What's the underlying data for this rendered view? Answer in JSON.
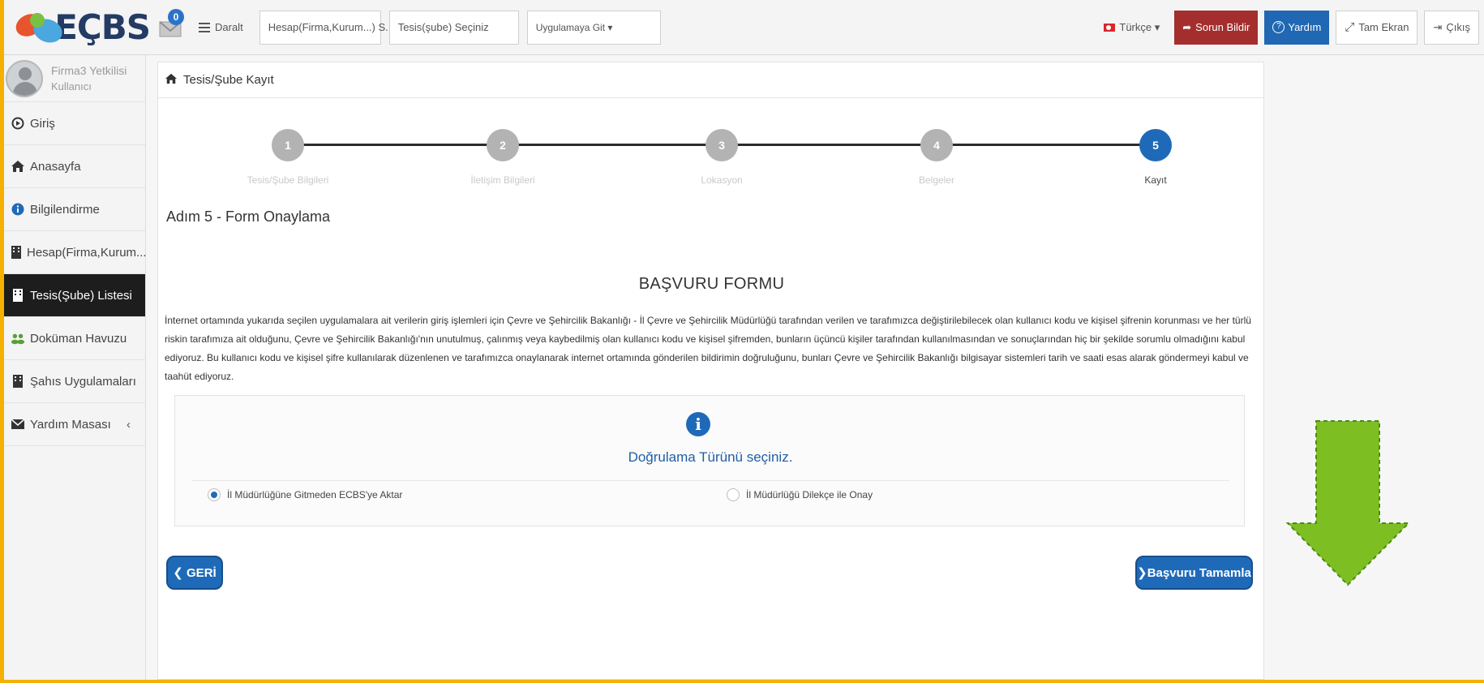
{
  "header": {
    "logo_text": "EÇBS",
    "mail_badge": "0",
    "collapse_label": "Daralt",
    "account_select": "Hesap(Firma,Kurum...) S...",
    "facility_select": "Tesis(şube) Seçiniz",
    "app_select": "Uygulamaya Git ▾",
    "language": "Türkçe ▾",
    "report_issue": "Sorun Bildir",
    "help": "Yardım",
    "fullscreen": "Tam Ekran",
    "logout": "Çıkış"
  },
  "sidebar": {
    "user_name": "Firma3 Yetkilisi",
    "user_role": "Kullanıcı",
    "items": [
      {
        "label": "Giriş",
        "icon": "sign-in-icon"
      },
      {
        "label": "Anasayfa",
        "icon": "home-icon"
      },
      {
        "label": "Bilgilendirme",
        "icon": "info-icon"
      },
      {
        "label": "Hesap(Firma,Kurum...)",
        "icon": "building-icon"
      },
      {
        "label": "Tesis(Şube) Listesi",
        "icon": "building-icon",
        "active": true
      },
      {
        "label": "Doküman Havuzu",
        "icon": "users-icon"
      },
      {
        "label": "Şahıs Uygulamaları",
        "icon": "building-icon"
      },
      {
        "label": "Yardım Masası",
        "icon": "envelope-icon"
      }
    ]
  },
  "page": {
    "breadcrumb": "Tesis/Şube Kayıt",
    "wizard_steps": [
      {
        "number": "1",
        "label": "Tesis/Şube Bilgileri"
      },
      {
        "number": "2",
        "label": "İletişim Bilgileri"
      },
      {
        "number": "3",
        "label": "Lokasyon"
      },
      {
        "number": "4",
        "label": "Belgeler"
      },
      {
        "number": "5",
        "label": "Kayıt",
        "current": true
      }
    ],
    "step_title": "Adım 5 - Form Onaylama",
    "form_title": "BAŞVURU FORMU",
    "legal_text": "İnternet ortamında yukarıda seçilen uygulamalara ait verilerin giriş işlemleri için Çevre ve Şehircilik Bakanlığı - İl Çevre ve Şehircilik Müdürlüğü tarafından verilen ve tarafımızca değiştirilebilecek olan kullanıcı kodu ve kişisel şifrenin korunması ve her türlü riskin tarafımıza ait olduğunu, Çevre ve Şehircilik Bakanlığı'nın unutulmuş, çalınmış veya kaybedilmiş olan kullanıcı kodu ve kişisel şifremden, bunların üçüncü kişiler tarafından kullanılmasından ve sonuçlarından hiç bir şekilde sorumlu olmadığını kabul ediyoruz. Bu kullanıcı kodu ve kişisel şifre kullanılarak düzenlenen ve tarafımızca onaylanarak internet ortamında gönderilen bildirimin doğruluğunu, bunları Çevre ve Şehircilik Bakanlığı bilgisayar sistemleri tarih ve saati esas alarak göndermeyi kabul ve taahüt ediyoruz.",
    "verify_title": "Doğrulama Türünü seçiniz.",
    "option_1": "İl Müdürlüğüne Gitmeden ECBS'ye Aktar",
    "option_2": "İl Müdürlüğü Dilekçe ile Onay",
    "selected_option": 1,
    "back_button": "❮ GERİ",
    "finish_button": "❯Başvuru Tamamla"
  },
  "colors": {
    "accent": "#1f6ab8",
    "active_nav": "#1d1d1d",
    "report_button": "#a42e2e",
    "frame": "#f6b000",
    "arrow": "#7dbf23"
  }
}
